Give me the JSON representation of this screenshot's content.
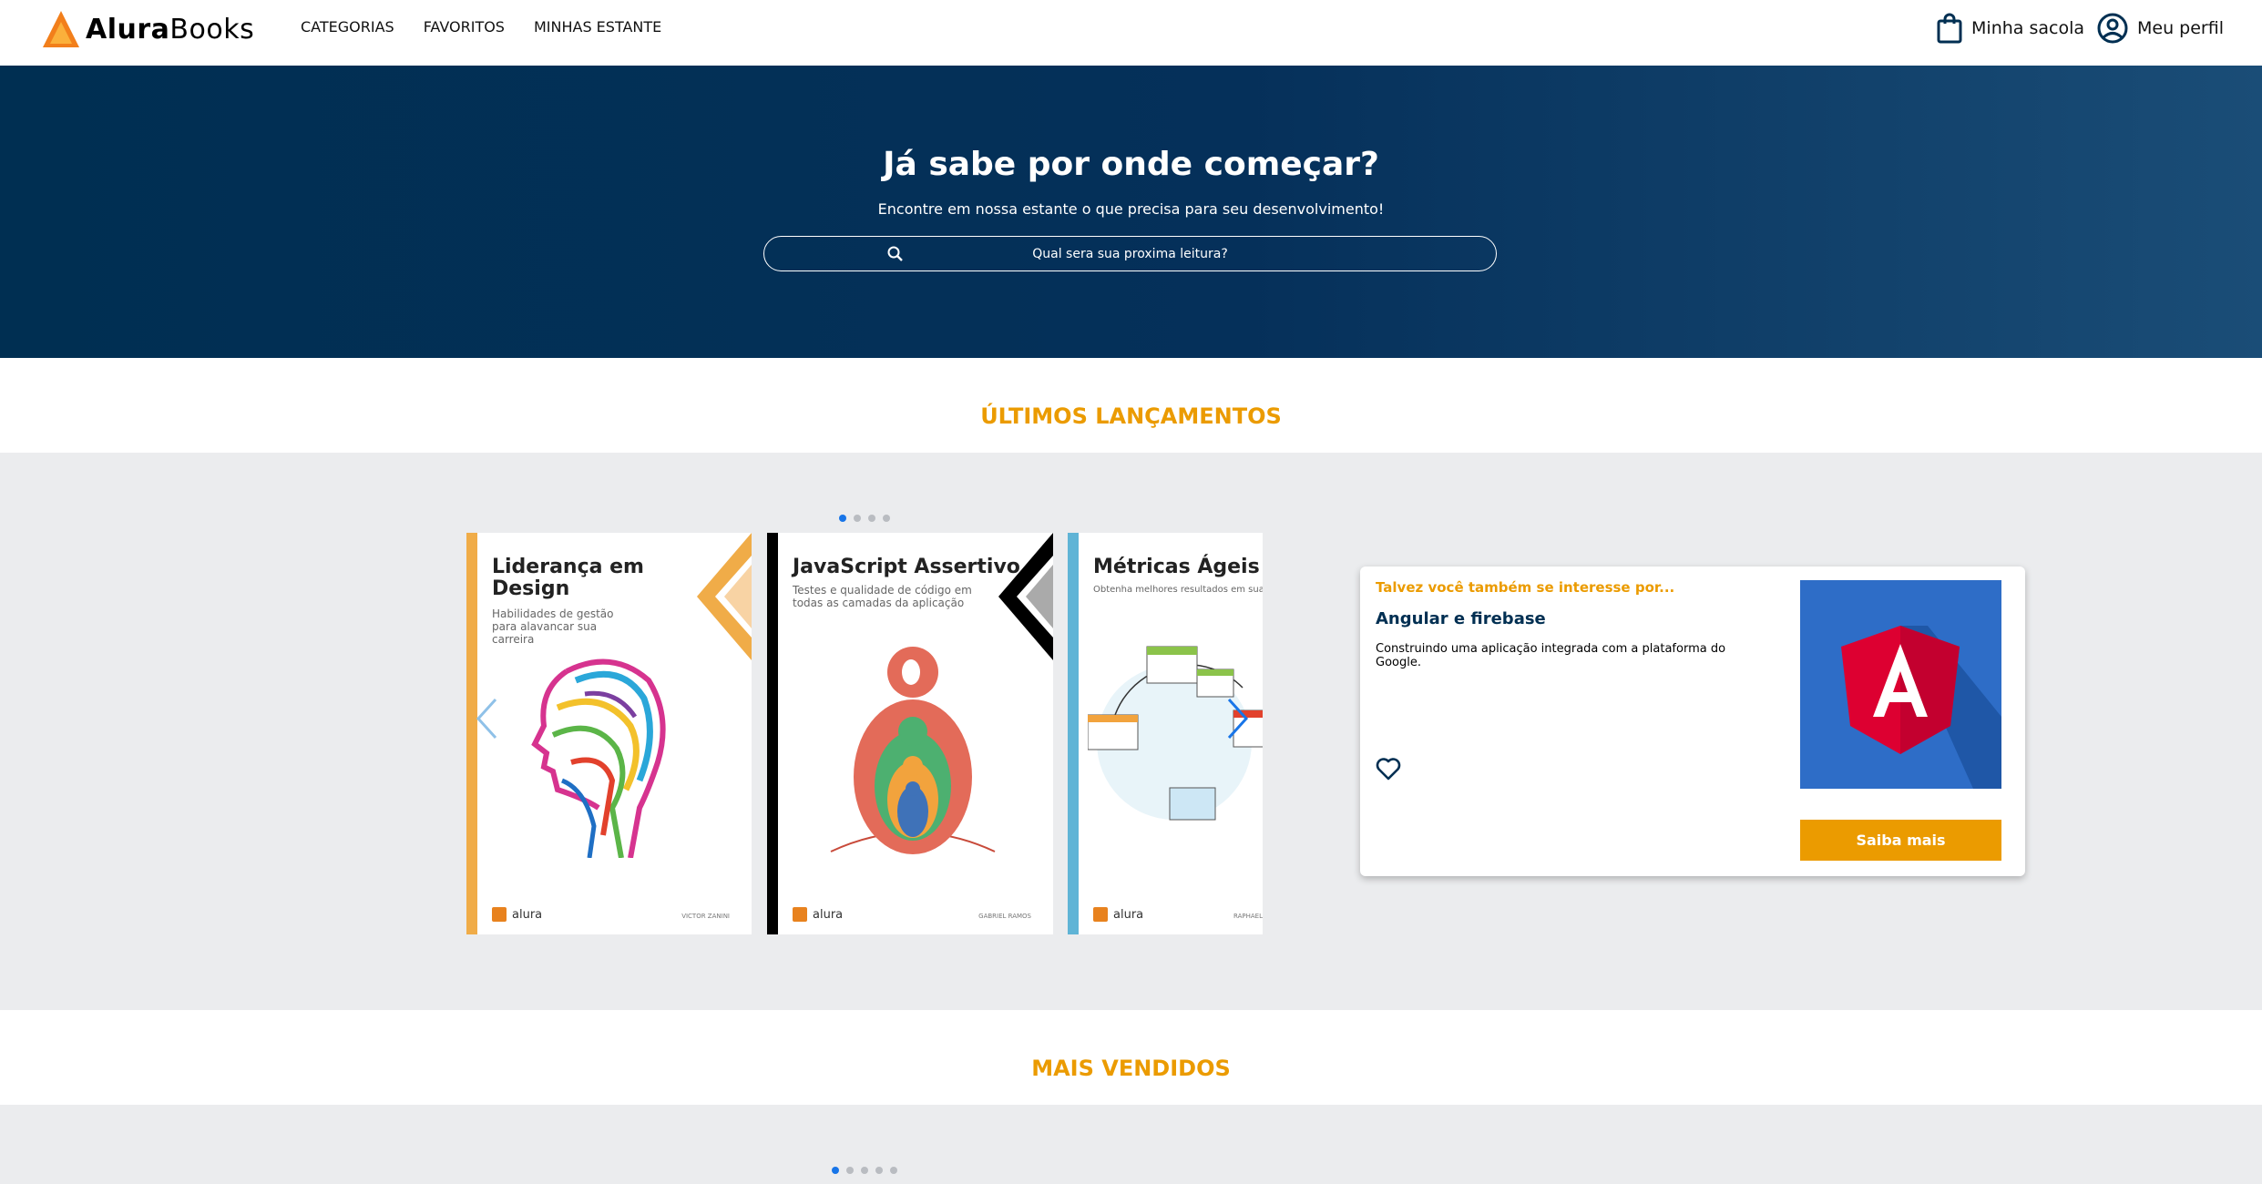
{
  "header": {
    "brand": {
      "first": "Alura",
      "second": "Books"
    },
    "nav": [
      "CATEGORIAS",
      "FAVORITOS",
      "MINHAS ESTANTE"
    ],
    "bag_label": "Minha sacola",
    "profile_label": "Meu perfil"
  },
  "hero": {
    "title": "Já sabe por onde começar?",
    "subtitle": "Encontre em nossa estante o que precisa para seu desenvolvimento!",
    "search_placeholder": "Qual sera sua proxima leitura?"
  },
  "latest": {
    "title": "ÚLTIMOS LANÇAMENTOS",
    "active_page": 1,
    "pages": 4,
    "books": [
      {
        "title": "Liderança em Design",
        "subtitle": "Habilidades de gestão para alavancar sua carreira",
        "publisher": "alura",
        "author": "VICTOR ZANINI",
        "stripe": "#f0ac48"
      },
      {
        "title": "JavaScript Assertivo",
        "subtitle": "Testes e qualidade de código em todas as camadas da aplicação",
        "publisher": "alura",
        "author": "GABRIEL RAMOS",
        "stripe": "#000000"
      },
      {
        "title": "Métricas Ágeis",
        "subtitle": "Obtenha melhores resultados em sua equipe",
        "publisher": "alura",
        "author": "RAPHAEL",
        "stripe": "#5fb4d6"
      }
    ]
  },
  "recommendation": {
    "kicker": "Talvez você também se interesse por...",
    "title": "Angular e firebase",
    "description": "Construindo uma aplicação integrada com a plataforma do Google.",
    "button": "Saiba mais",
    "image_icon": "angular-logo",
    "colors": {
      "accent": "#eb9b00",
      "image_bg": "#2e6dc7",
      "logo_red": "#dd0031"
    }
  },
  "best_sellers": {
    "title": "MAIS VENDIDOS",
    "active_page": 1,
    "pages": 5
  }
}
